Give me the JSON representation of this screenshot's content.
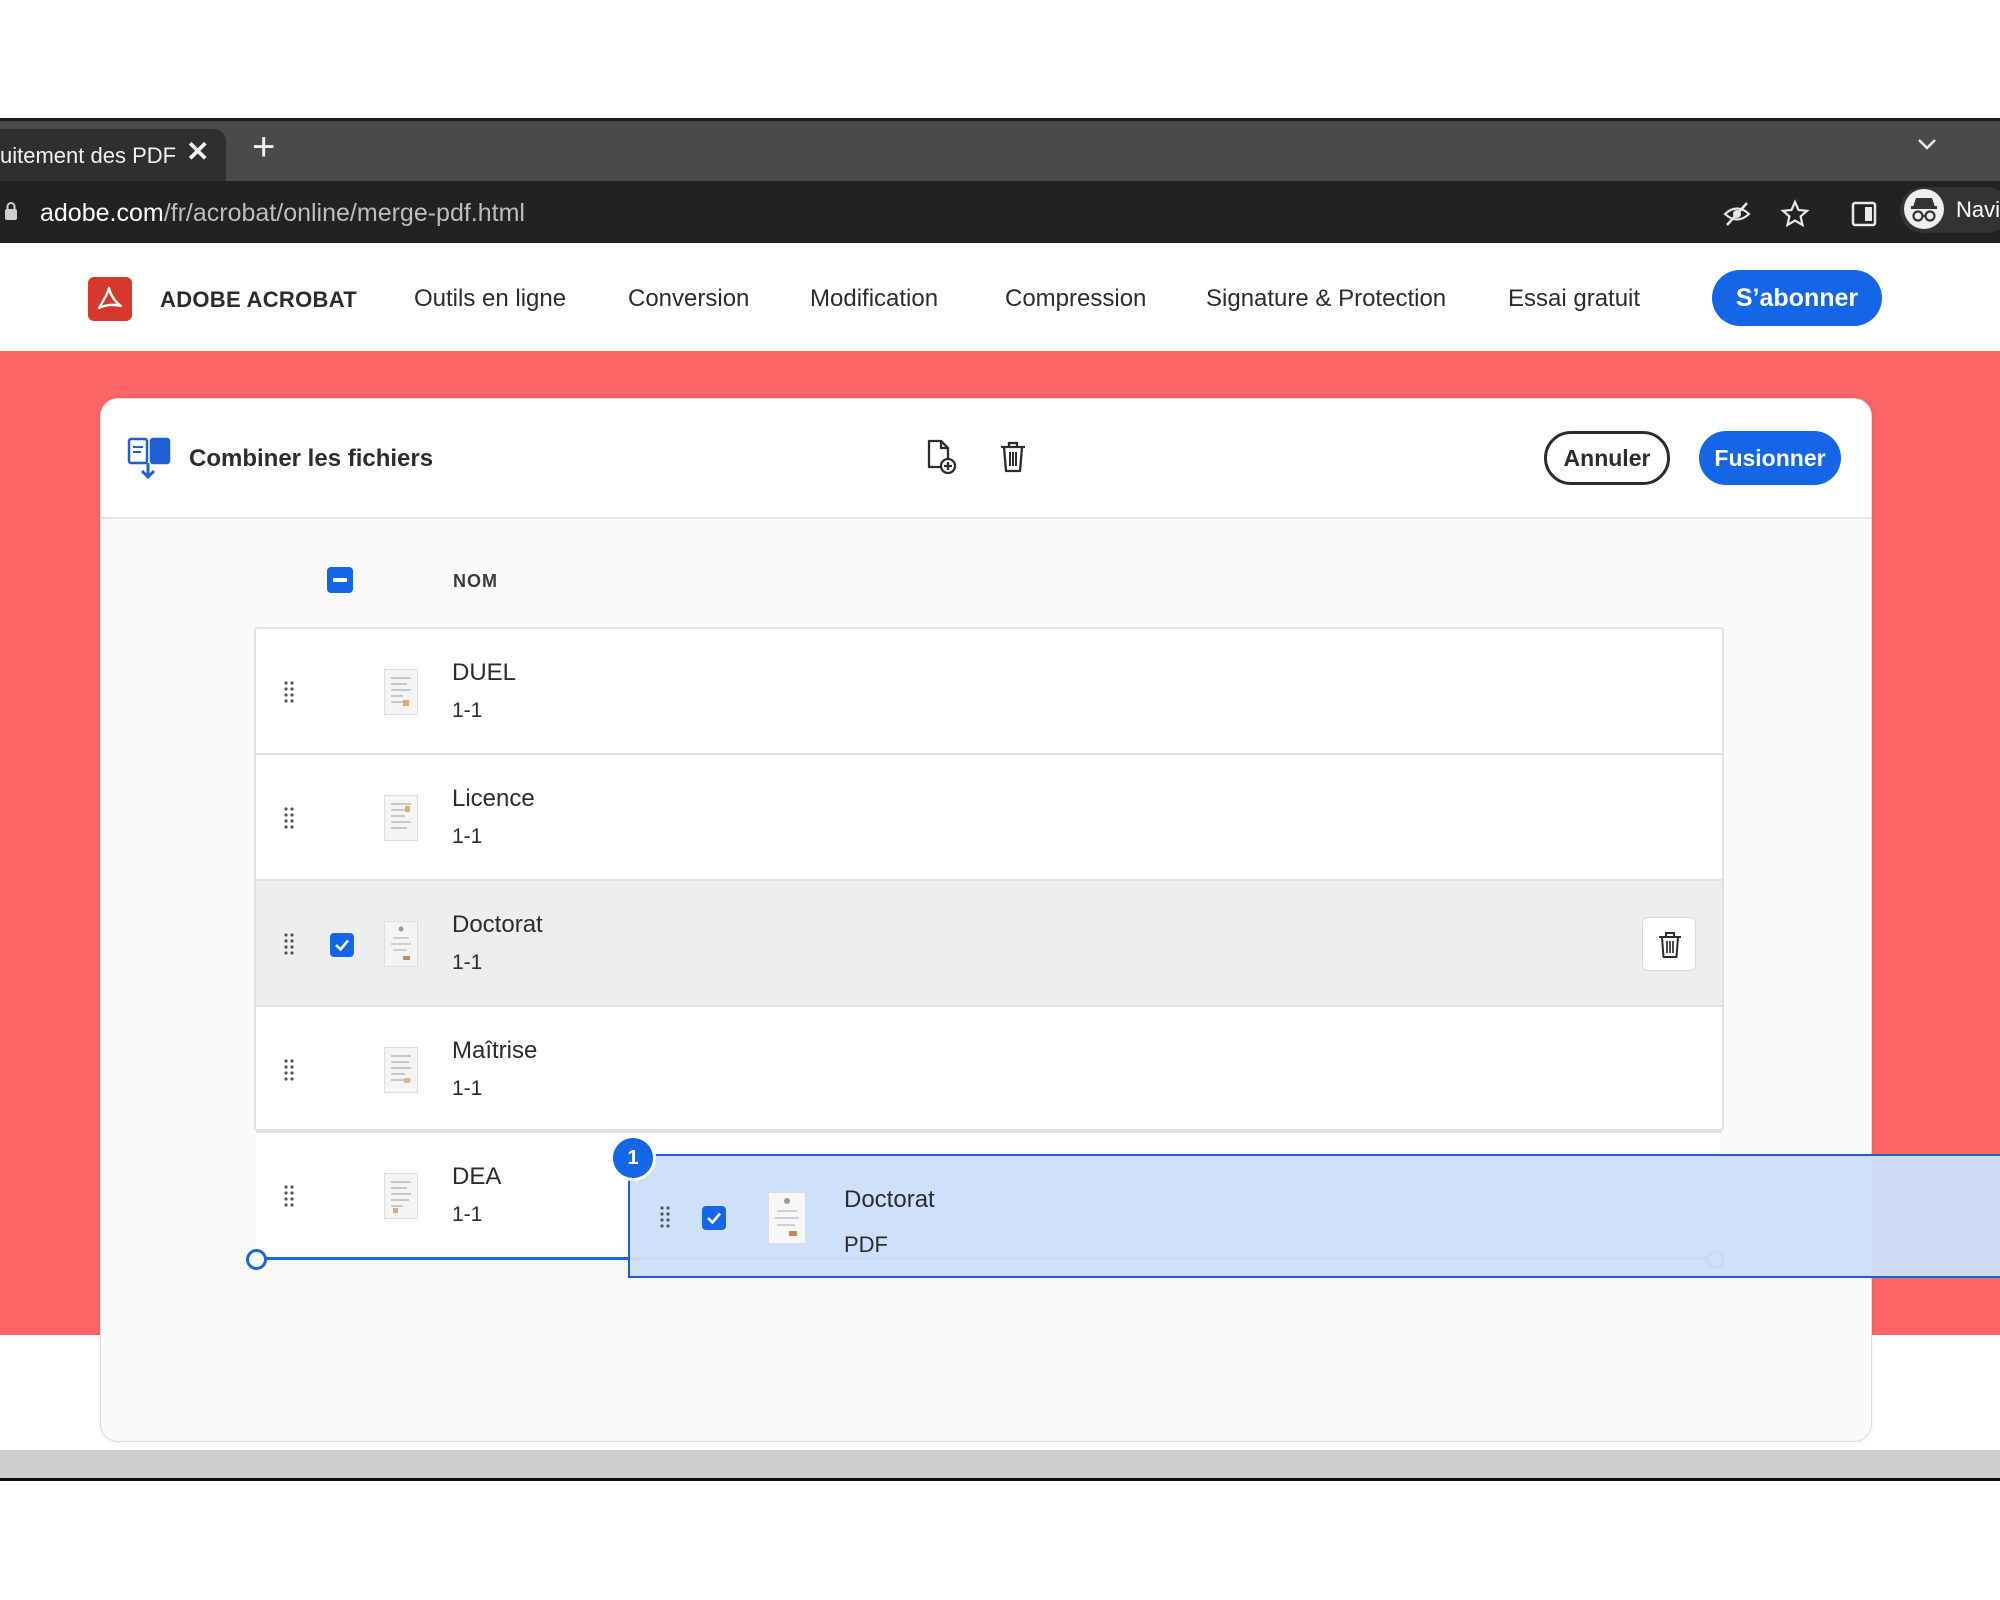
{
  "browser": {
    "tab_title": "uitement des PDF",
    "tab_close_glyph": "✕",
    "new_tab_glyph": "+",
    "url_host": "adobe.com",
    "url_path": "/fr/acrobat/online/merge-pdf.html",
    "profile_label": "Navi",
    "icons": [
      "lock-icon",
      "eye-off-icon",
      "star-icon",
      "reading-list-icon",
      "incognito-icon",
      "tab-search-icon"
    ]
  },
  "header": {
    "brand": "ADOBE ACROBAT",
    "nav": [
      "Outils en ligne",
      "Conversion",
      "Modification",
      "Compression",
      "Signature & Protection",
      "Essai gratuit"
    ],
    "subscribe_label": "S’abonner",
    "colors": {
      "accent": "#1466e6",
      "logo": "#d7372c",
      "hero": "#fb6566"
    }
  },
  "card": {
    "title": "Combiner les fichiers",
    "cancel_label": "Annuler",
    "merge_label": "Fusionner",
    "column_header": "NOM",
    "select_all_state": "indeterminate"
  },
  "files": [
    {
      "name": "DUEL",
      "pages": "1-1",
      "selected": false
    },
    {
      "name": "Licence",
      "pages": "1-1",
      "selected": false
    },
    {
      "name": "Doctorat",
      "pages": "1-1",
      "selected": true
    },
    {
      "name": "Maîtrise",
      "pages": "1-1",
      "selected": false
    },
    {
      "name": "DEA",
      "pages": "1-1",
      "selected": false
    }
  ],
  "drag": {
    "count": "1",
    "name": "Doctorat",
    "type": "PDF"
  }
}
